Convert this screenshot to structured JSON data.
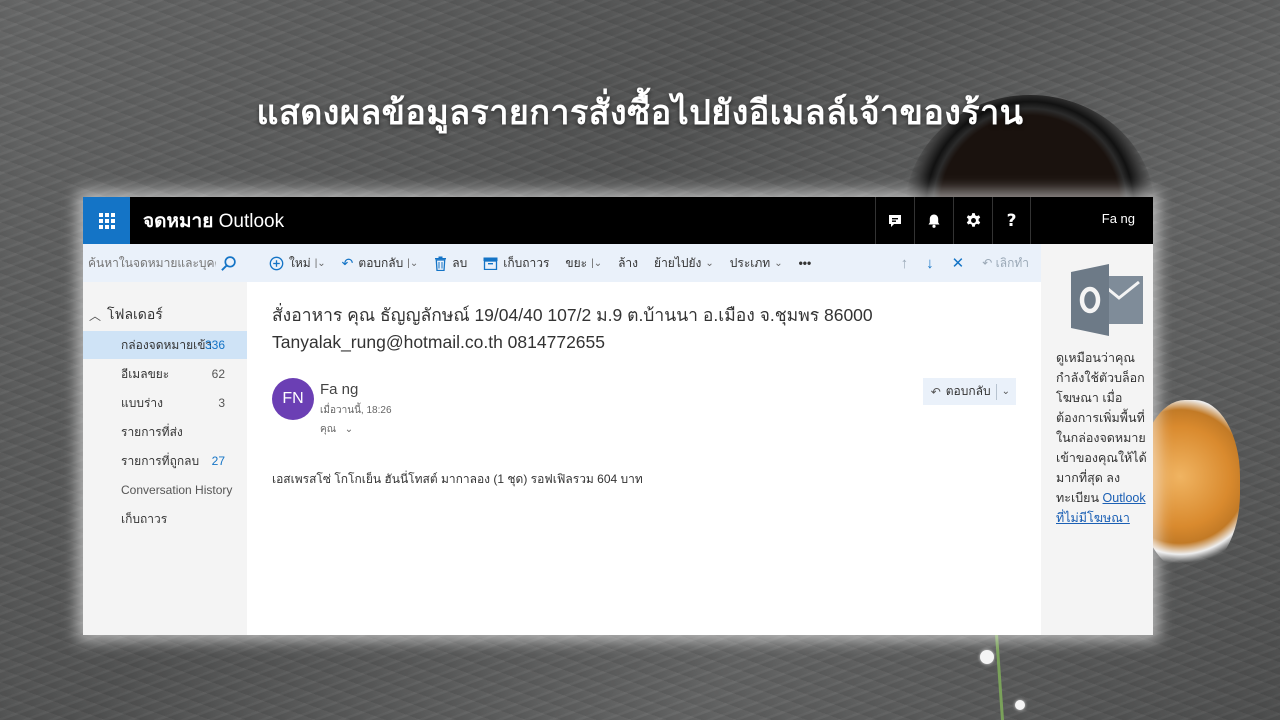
{
  "slide": {
    "title": "แสดงผลข้อมูลรายการสั่งซื้อไปยังอีเมลล์เจ้าของร้าน"
  },
  "app": {
    "title_bold": "จดหมาย",
    "title_rest": " Outlook",
    "user_name": "Fa ng",
    "header_icons": [
      "feedback-icon",
      "bell-icon",
      "gear-icon",
      "help-icon"
    ],
    "help_glyph": "?",
    "accent_color": "#1474c6"
  },
  "search": {
    "placeholder": "ค้นหาในจดหมายและบุคคล"
  },
  "toolbar": {
    "new_label": "ใหม่",
    "reply_label": "ตอบกลับ",
    "delete_label": "ลบ",
    "archive_label": "เก็บถาวร",
    "junk_label": "ขยะ",
    "sweep_label": "ล้าง",
    "move_label": "ย้ายไปยัง",
    "categorize_label": "ประเภท",
    "more_label": "•••",
    "undo_label": "เลิกทำ"
  },
  "sidebar": {
    "folders_label": "โฟลเดอร์",
    "folders": [
      {
        "label": "กล่องจดหมายเข้า",
        "count": "336"
      },
      {
        "label": "อีเมลขยะ",
        "count": "62"
      },
      {
        "label": "แบบร่าง",
        "count": "3"
      },
      {
        "label": "รายการที่ส่ง",
        "count": ""
      },
      {
        "label": "รายการที่ถูกลบ",
        "count": "27"
      },
      {
        "label": "Conversation History",
        "count": ""
      },
      {
        "label": "เก็บถาวร",
        "count": ""
      }
    ]
  },
  "message": {
    "subject_line1": "สั่งอาหาร คุณ ธัญญลักษณ์ 19/04/40 107/2 ม.9 ต.บ้านนา อ.เมือง จ.ชุมพร 86000",
    "subject_line2": "Tanyalak_rung@hotmail.co.th 0814772655",
    "avatar_initials": "FN",
    "avatar_color": "#6b3fb4",
    "sender": "Fa ng",
    "sent_time": "เมื่อวานนี้, 18:26",
    "recipient": "คุณ",
    "reply_button": "ตอบกลับ",
    "body": "เอสเพรสโซ่ โกโกเย็น ฮันนี่โทสต์ มากาลอง (1 ชุด) รอฟเฟิลรวม 604 บาท"
  },
  "ad": {
    "text": "ดูเหมือนว่าคุณกำลังใช้ตัวบล็อกโฆษณา เมื่อต้องการเพิ่มพื้นที่ในกล่องจดหมายเข้าของคุณให้ได้มากที่สุด ลงทะเบียน ",
    "link": "Outlook ที่ไม่มีโฆษณา"
  }
}
